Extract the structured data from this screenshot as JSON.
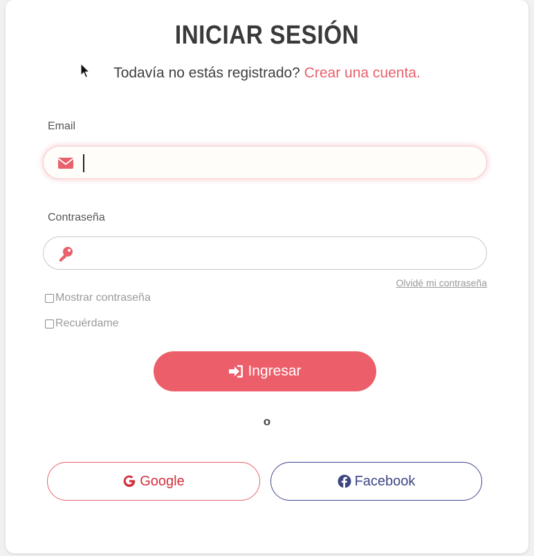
{
  "title": "INICIAR SESIÓN",
  "subtitle": {
    "text": "Todavía no estás registrado? ",
    "link": "Crear una cuenta."
  },
  "email": {
    "label": "Email",
    "value": "",
    "icon": "envelope-icon"
  },
  "password": {
    "label": "Contraseña",
    "value": "",
    "icon": "key-icon",
    "forgot": "Olvidé mi contraseña"
  },
  "options": {
    "show_password": "Mostrar contraseña",
    "remember": "Recuérdame"
  },
  "submit": {
    "label": "Ingresar",
    "icon": "sign-in-icon"
  },
  "separator": "o",
  "social": {
    "google": "Google",
    "facebook": "Facebook"
  },
  "colors": {
    "accent": "#ec5f6a",
    "google": "#d3303c",
    "facebook": "#3f468c"
  }
}
